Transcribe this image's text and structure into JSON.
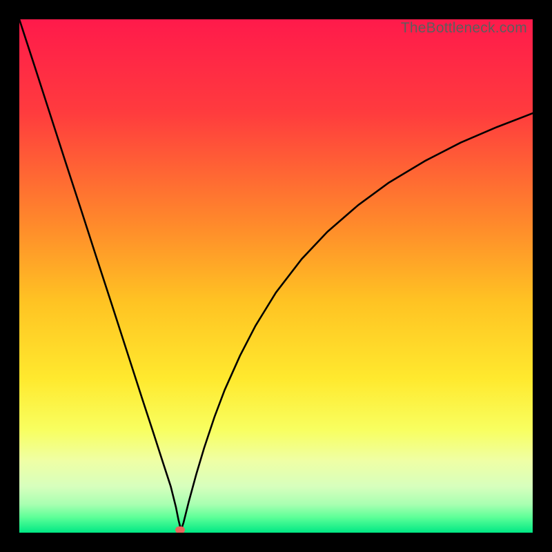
{
  "watermark": "TheBottleneck.com",
  "marker_color": "#e8675c",
  "chart_data": {
    "type": "line",
    "title": "",
    "xlabel": "",
    "ylabel": "",
    "xlim": [
      0,
      100
    ],
    "ylim": [
      0,
      100
    ],
    "gradient_stops": [
      {
        "offset": 0,
        "color": "#ff1a4b"
      },
      {
        "offset": 0.18,
        "color": "#ff3b3e"
      },
      {
        "offset": 0.4,
        "color": "#ff8a2b"
      },
      {
        "offset": 0.55,
        "color": "#ffc323"
      },
      {
        "offset": 0.7,
        "color": "#ffe92e"
      },
      {
        "offset": 0.8,
        "color": "#f8ff60"
      },
      {
        "offset": 0.86,
        "color": "#efffa5"
      },
      {
        "offset": 0.91,
        "color": "#d7ffbd"
      },
      {
        "offset": 0.945,
        "color": "#a8ffb1"
      },
      {
        "offset": 0.97,
        "color": "#5dff98"
      },
      {
        "offset": 1.0,
        "color": "#00e884"
      }
    ],
    "curve_left": {
      "x": [
        0,
        3,
        6,
        9,
        12,
        15,
        18,
        21,
        24,
        26,
        28,
        29.5,
        30.5,
        31,
        31.5
      ],
      "y": [
        100,
        90.8,
        81.5,
        72.2,
        63.0,
        53.7,
        44.5,
        35.2,
        25.9,
        19.8,
        13.6,
        9.0,
        5.0,
        2.5,
        0.5
      ]
    },
    "curve_right": {
      "x": [
        31.5,
        32,
        33,
        34.5,
        36,
        38,
        40,
        43,
        46,
        50,
        55,
        60,
        66,
        72,
        79,
        86,
        93,
        100
      ],
      "y": [
        0.5,
        2.0,
        6.0,
        11.5,
        16.5,
        22.5,
        27.8,
        34.5,
        40.3,
        46.8,
        53.3,
        58.6,
        63.8,
        68.2,
        72.4,
        76.0,
        79.0,
        81.7
      ]
    },
    "marker": {
      "x": 31.3,
      "y": 0.5
    }
  }
}
